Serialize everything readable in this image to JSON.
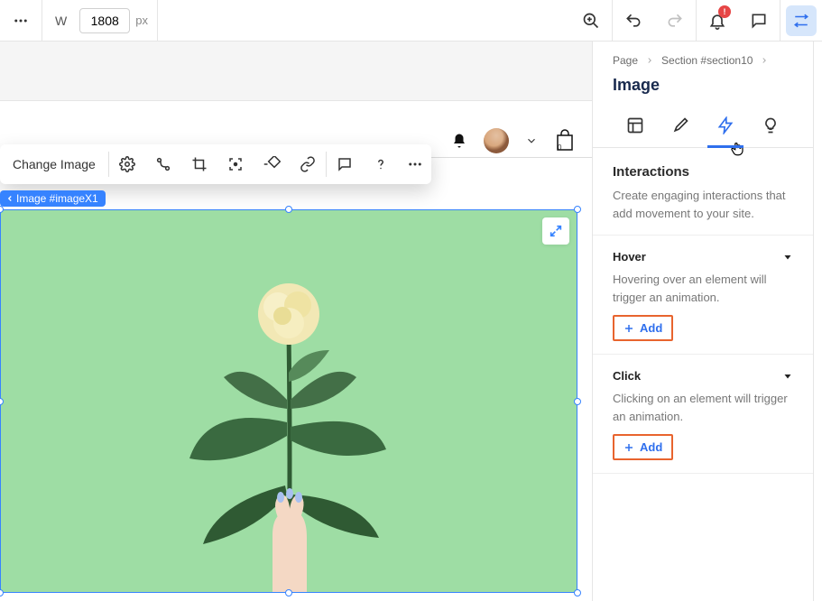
{
  "topbar": {
    "w_label": "W",
    "width_value": "1808",
    "px_label": "px",
    "notification_count": "!"
  },
  "toolbar": {
    "change_image": "Change Image"
  },
  "selection": {
    "badge": "Image #imageX1"
  },
  "canvas_header": {
    "cart_count": "0"
  },
  "panel": {
    "breadcrumb": {
      "page": "Page",
      "section": "Section #section10"
    },
    "title": "Image",
    "interactions": {
      "title": "Interactions",
      "desc": "Create engaging interactions that add movement to your site."
    },
    "hover": {
      "title": "Hover",
      "desc": "Hovering over an element will trigger an animation.",
      "add_label": "Add"
    },
    "click": {
      "title": "Click",
      "desc": "Clicking on an element will trigger an animation.",
      "add_label": "Add"
    }
  }
}
